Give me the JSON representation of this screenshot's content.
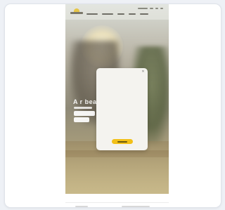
{
  "hero": {
    "headline_visible_fragment": "A r bea"
  },
  "colors": {
    "accent": "#f2c018",
    "logo": "#e7c648",
    "card_bg": "#ffffff",
    "page_bg": "#eef1f6",
    "modal_bg": "#f4f3ef"
  },
  "icons": {
    "modal_close": "close-icon"
  }
}
